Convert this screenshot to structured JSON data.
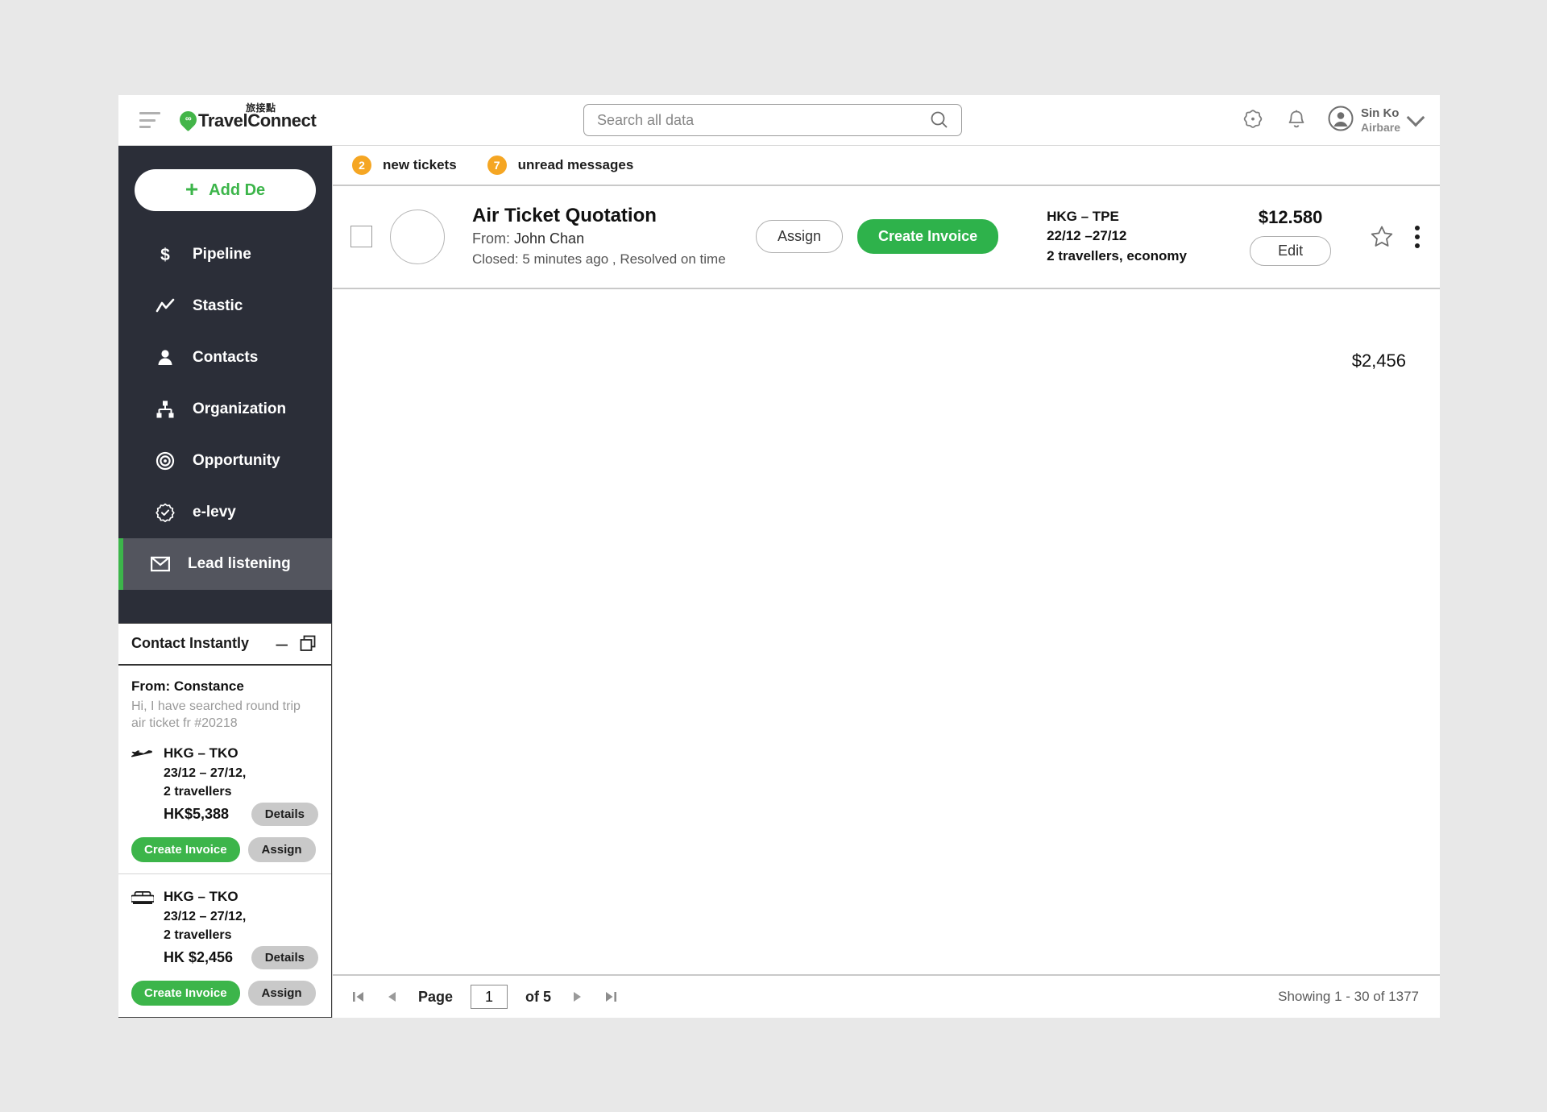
{
  "header": {
    "menu_icon": "hamburger-icon",
    "brand_name": "TravelConnect",
    "brand_cjk": "旅接點",
    "search": {
      "placeholder": "Search all data",
      "value": "",
      "icon": "search-icon"
    },
    "settings_icon": "gear-icon",
    "notifications_icon": "bell-icon",
    "user": {
      "name": "Sin Ko",
      "org": "Airbare",
      "avatar_icon": "user-avatar-icon",
      "chevron_icon": "chevron-down-icon"
    }
  },
  "sidebar": {
    "add_button": {
      "label": "Add De",
      "icon": "plus-icon"
    },
    "items": [
      {
        "label": "Pipeline",
        "icon": "dollar-icon",
        "active": false
      },
      {
        "label": "Stastic",
        "icon": "line-chart-icon",
        "active": false
      },
      {
        "label": "Contacts",
        "icon": "person-icon",
        "active": false
      },
      {
        "label": "Organization",
        "icon": "org-chart-icon",
        "active": false
      },
      {
        "label": "Opportunity",
        "icon": "target-icon",
        "active": false
      },
      {
        "label": "e-levy",
        "icon": "badge-check-icon",
        "active": false
      },
      {
        "label": "Lead listening",
        "icon": "envelope-icon",
        "active": true
      }
    ]
  },
  "contact_instantly": {
    "title": "Contact Instantly",
    "minimize_icon": "minimize-icon",
    "restore_icon": "restore-window-icon",
    "cards": [
      {
        "from": "From: Constance",
        "message": "Hi, I have searched round trip air ticket fr #20218",
        "trip_icon": "airplane-icon",
        "route": "HKG – TKO",
        "dates": "23/12 – 27/12,",
        "travellers": "2 travellers",
        "price": "HK$5,388",
        "details_label": "Details",
        "create_invoice_label": "Create Invoice",
        "assign_label": "Assign"
      },
      {
        "from": "",
        "message": "",
        "trip_icon": "bed-icon",
        "route": "HKG – TKO",
        "dates": "23/12 – 27/12,",
        "travellers": "2 travellers",
        "price": "HK $2,456",
        "details_label": "Details",
        "create_invoice_label": "Create Invoice",
        "assign_label": "Assign"
      }
    ]
  },
  "notifications": {
    "new_tickets_count": "2",
    "new_tickets_label": "new tickets",
    "unread_count": "7",
    "unread_label": "unread messages"
  },
  "list": {
    "rows": [
      {
        "checked": false,
        "avatar_icon": "empty-avatar-icon",
        "title": "Air Ticket Quotation",
        "from_prefix": "From:",
        "from_name": "John Chan",
        "status": "Closed: 5 minutes ago , Resolved on time",
        "assign_label": "Assign",
        "create_invoice_label": "Create Invoice",
        "route": "HKG – TPE",
        "dates": "22/12 –27/12",
        "travellers": "2 travellers, economy",
        "price": "$12.580",
        "edit_label": "Edit",
        "star_icon": "star-outline-icon",
        "menu_icon": "kebab-menu-icon"
      }
    ],
    "floating_amount": "$2,456"
  },
  "footer": {
    "first_icon": "first-page-icon",
    "prev_icon": "prev-page-icon",
    "page_label": "Page",
    "page_value": "1",
    "of_label": "of 5",
    "next_icon": "next-page-icon",
    "last_icon": "last-page-icon",
    "showing": "Showing 1 - 30 of 1377"
  },
  "colors": {
    "accent_green": "#3cb54a",
    "sidebar_bg": "#2b2e38",
    "sidebar_active": "#53555e",
    "badge_orange": "#f5a623"
  }
}
